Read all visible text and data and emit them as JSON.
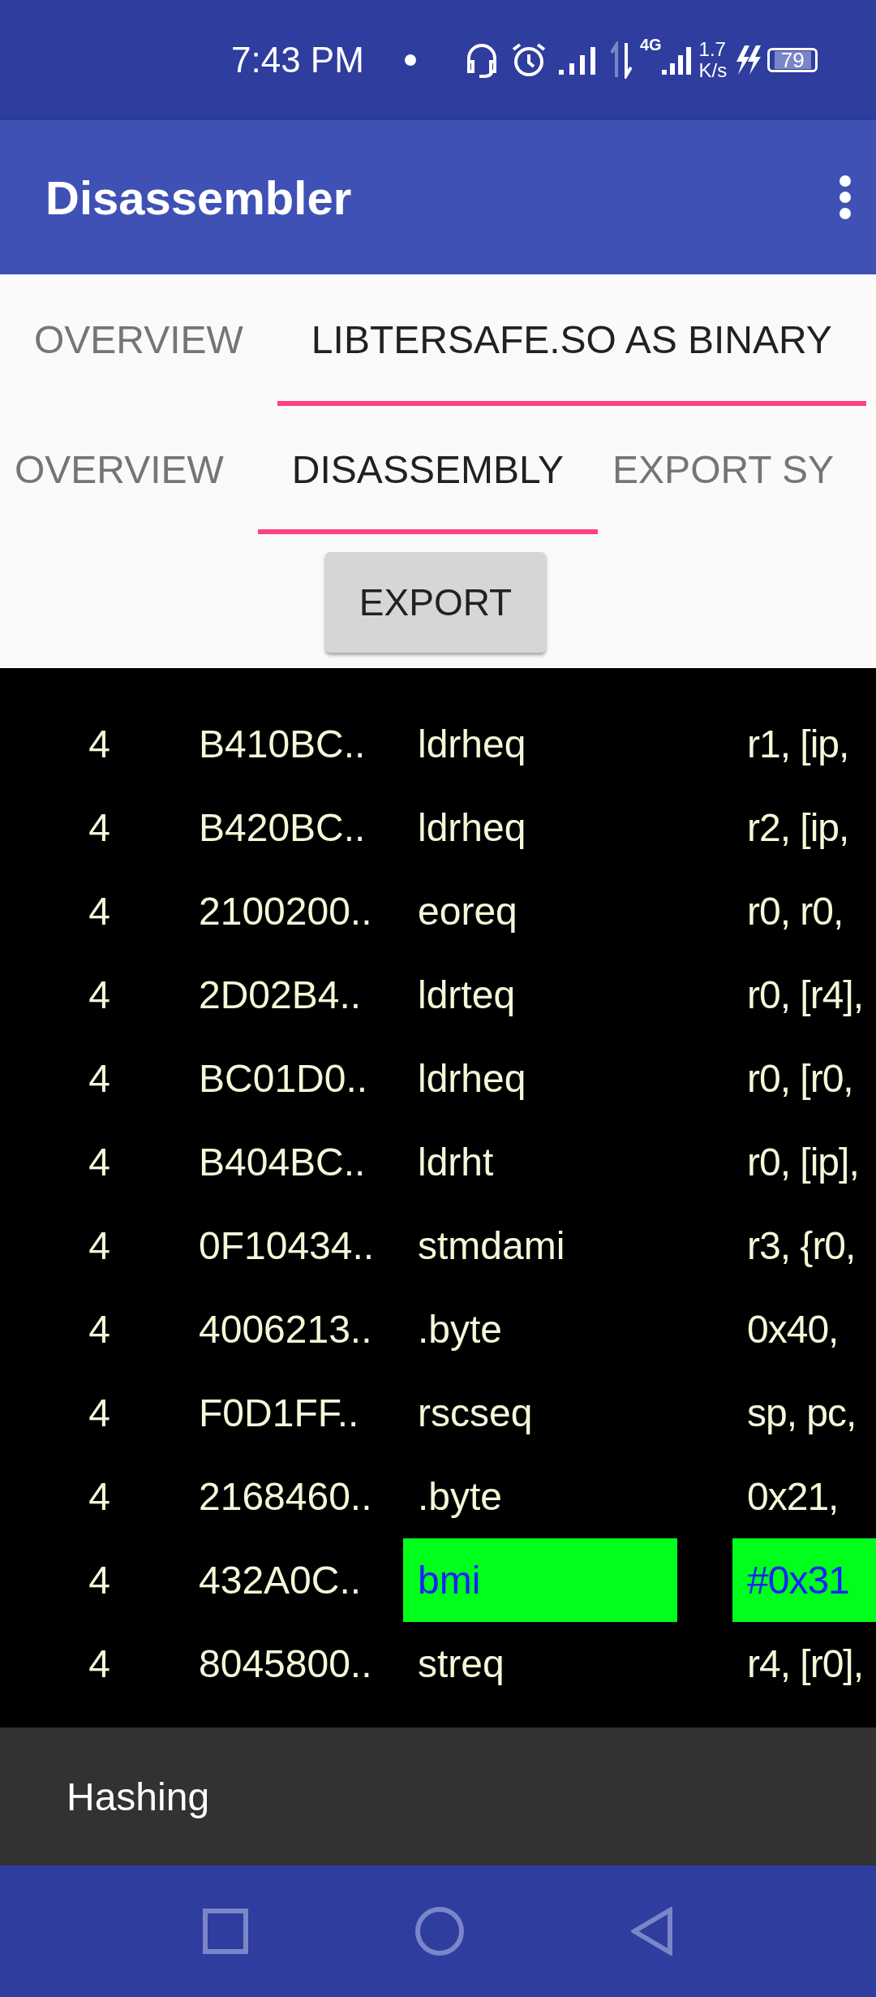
{
  "status_bar": {
    "time": "7:43 PM",
    "network_type": "4G",
    "speed_value": "1.7",
    "speed_unit": "K/s",
    "battery": "79"
  },
  "app_bar": {
    "title": "Disassembler"
  },
  "file_tabs": [
    {
      "label": "OVERVIEW",
      "selected": false
    },
    {
      "label": "LIBTERSAFE.SO AS BINARY",
      "selected": true
    }
  ],
  "section_tabs": [
    {
      "label": "OVERVIEW",
      "selected": false
    },
    {
      "label": "DISASSEMBLY",
      "selected": true
    },
    {
      "label": "EXPORT SY",
      "selected": false
    }
  ],
  "export_button": "EXPORT",
  "rows": [
    {
      "size": "4",
      "bytes": "B410BC..",
      "mnemonic": "ldrheq",
      "operands": "r1, [ip,",
      "highlighted": false
    },
    {
      "size": "4",
      "bytes": "B420BC..",
      "mnemonic": "ldrheq",
      "operands": "r2, [ip,",
      "highlighted": false
    },
    {
      "size": "4",
      "bytes": "2100200..",
      "mnemonic": "eoreq",
      "operands": "r0, r0,",
      "highlighted": false
    },
    {
      "size": "4",
      "bytes": "2D02B4..",
      "mnemonic": "ldrteq",
      "operands": "r0, [r4],",
      "highlighted": false
    },
    {
      "size": "4",
      "bytes": "BC01D0..",
      "mnemonic": "ldrheq",
      "operands": "r0, [r0,",
      "highlighted": false
    },
    {
      "size": "4",
      "bytes": "B404BC..",
      "mnemonic": "ldrht",
      "operands": "r0, [ip],",
      "highlighted": false
    },
    {
      "size": "4",
      "bytes": "0F10434..",
      "mnemonic": "stmdami",
      "operands": "r3, {r0,",
      "highlighted": false
    },
    {
      "size": "4",
      "bytes": "4006213..",
      "mnemonic": ".byte",
      "operands": "0x40,",
      "highlighted": false
    },
    {
      "size": "4",
      "bytes": "F0D1FF..",
      "mnemonic": "rscseq",
      "operands": "sp, pc,",
      "highlighted": false
    },
    {
      "size": "4",
      "bytes": "2168460..",
      "mnemonic": ".byte",
      "operands": "0x21,",
      "highlighted": false
    },
    {
      "size": "4",
      "bytes": "432A0C..",
      "mnemonic": "bmi",
      "operands": "#0x31",
      "highlighted": true
    },
    {
      "size": "4",
      "bytes": "8045800..",
      "mnemonic": "streq",
      "operands": "r4, [r0],",
      "highlighted": false
    }
  ],
  "snackbar": {
    "message": "Hashing"
  }
}
